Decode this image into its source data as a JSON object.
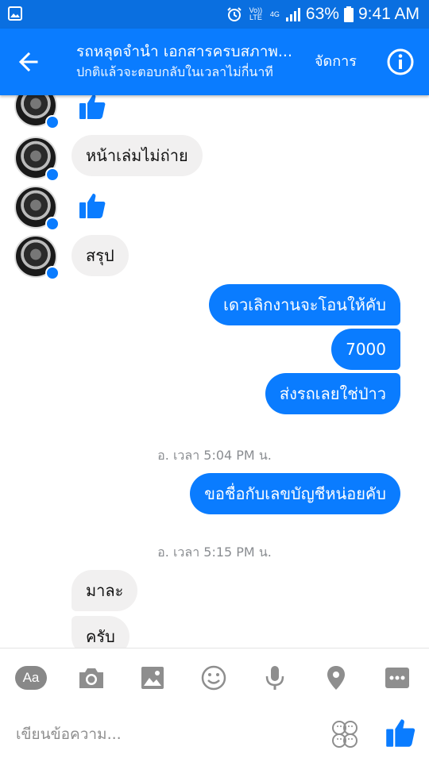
{
  "status_bar": {
    "volte": "Vo)) LTE",
    "network": "4G",
    "battery": "63%",
    "time": "9:41 AM"
  },
  "header": {
    "title": "รถหลุดจำนำ เอกสารครบสภาพ...",
    "subtitle": "ปกติแล้วจะตอบกลับในเวลาไม่กี่นาที",
    "manage_label": "จัดการ"
  },
  "messages": {
    "in_1": "หน้าเล่มไม่ถ่าย",
    "in_2": "สรุป",
    "out_1": "เดวเลิกงานจะโอนให้คับ",
    "out_2": "7000",
    "out_3": "ส่งรถเลยใช่ป่าว",
    "time_1": "อ. เวลา 5:04 PM น.",
    "out_4": "ขอชื่อกับเลขบัญชีหน่อยคับ",
    "time_2": "อ. เวลา 5:15 PM น.",
    "in_3": "มาละ",
    "in_4": "ครับ"
  },
  "composer": {
    "aa_label": "Aa",
    "placeholder": "เขียนข้อความ..."
  },
  "colors": {
    "brand": "#0a7cff",
    "status_bar": "#0a6fe0",
    "incoming_bubble": "#f1f0f0",
    "timestamp": "#8a8d91",
    "icon_gray": "#8e8e8e"
  }
}
